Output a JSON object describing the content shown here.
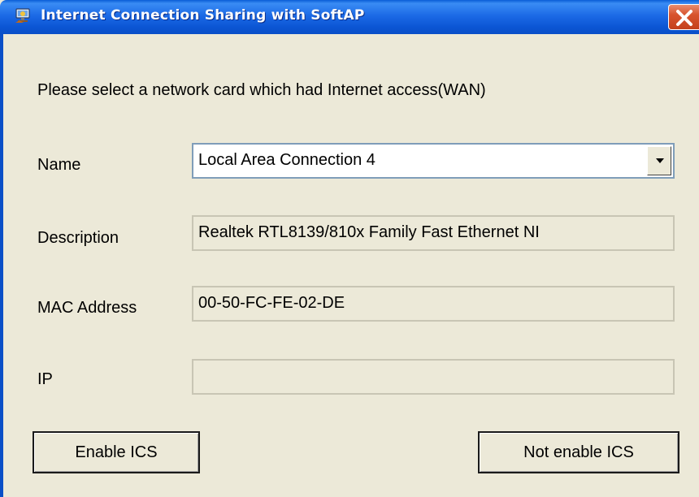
{
  "window": {
    "title": "Internet  Connection Sharing with SoftAP",
    "icon": "network-share-icon",
    "close_icon": "close-icon"
  },
  "instruction": "Please select a network card which had Internet access(WAN)",
  "form": {
    "name": {
      "label": "Name",
      "value": "Local Area Connection 4"
    },
    "description": {
      "label": "Description",
      "value": "Realtek RTL8139/810x Family Fast Ethernet NI"
    },
    "mac": {
      "label": "MAC Address",
      "value": "00-50-FC-FE-02-DE"
    },
    "ip": {
      "label": "IP",
      "value": ""
    }
  },
  "buttons": {
    "enable": "Enable ICS",
    "not_enable": "Not enable ICS"
  },
  "colors": {
    "titlebar": "#0a5ed7",
    "background": "#ece9d8",
    "close_button": "#d8542e"
  }
}
